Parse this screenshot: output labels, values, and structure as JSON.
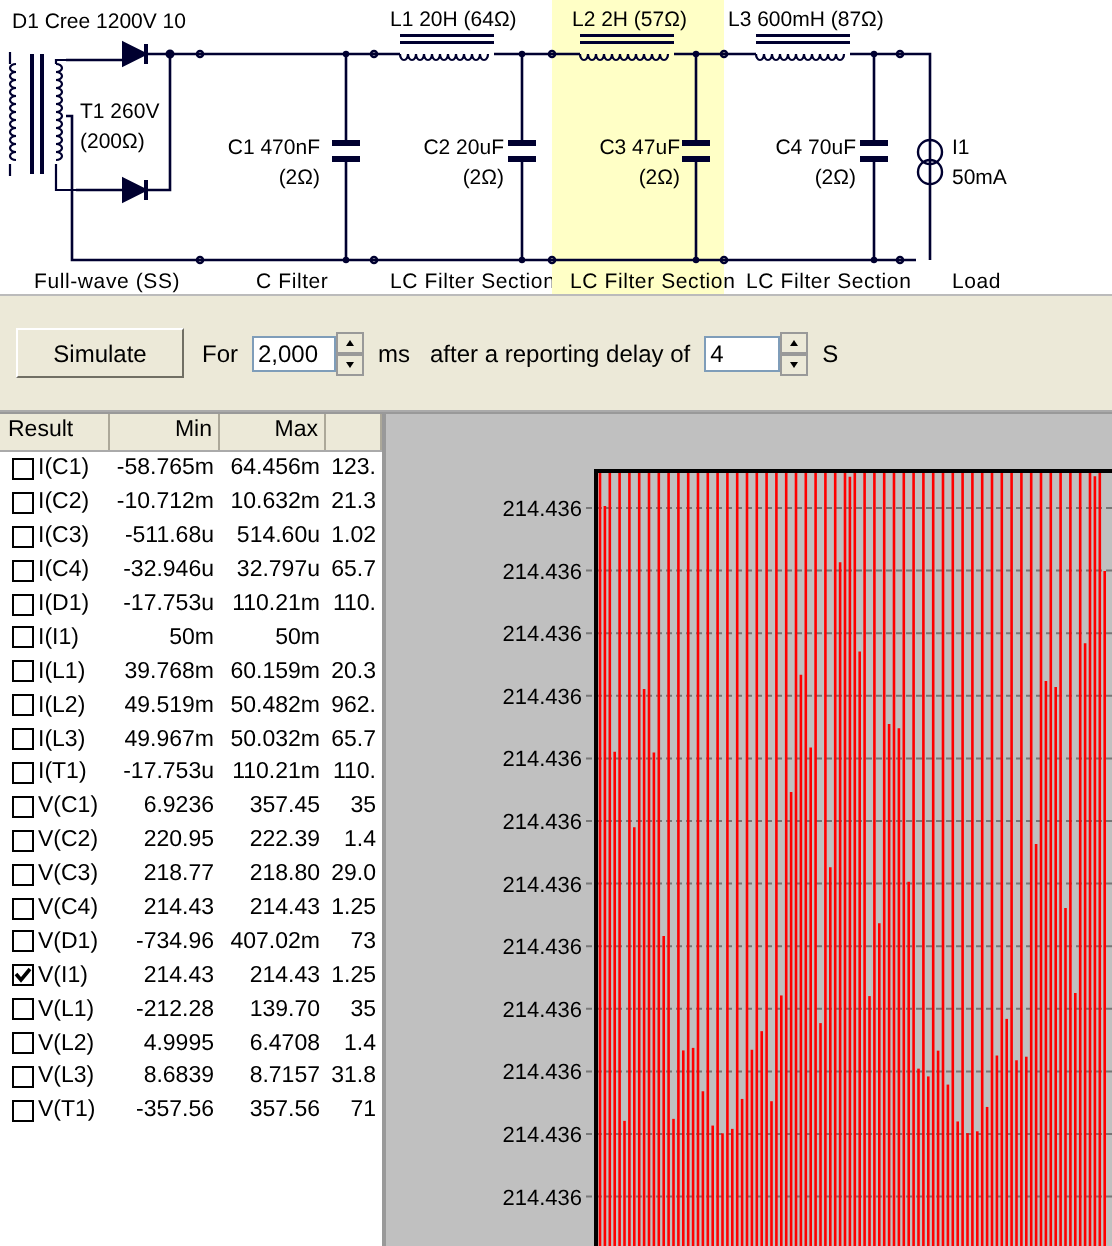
{
  "schematic": {
    "components": [
      {
        "kind": "diode",
        "name": "D1 Cree 1200V 10"
      },
      {
        "kind": "transformer",
        "name": "T1 260V",
        "detail": "(200Ω)"
      },
      {
        "kind": "capacitor",
        "name": "C1 470nF",
        "detail": "(2Ω)"
      },
      {
        "kind": "inductor",
        "name": "L1 20H (64Ω)"
      },
      {
        "kind": "capacitor",
        "name": "C2 20uF",
        "detail": "(2Ω)"
      },
      {
        "kind": "inductor",
        "name": "L2 2H (57Ω)"
      },
      {
        "kind": "capacitor",
        "name": "C3 47uF",
        "detail": "(2Ω)"
      },
      {
        "kind": "inductor",
        "name": "L3 600mH (87Ω)"
      },
      {
        "kind": "capacitor",
        "name": "C4 70uF",
        "detail": "(2Ω)"
      },
      {
        "kind": "current-source",
        "name": "I1",
        "detail": "50mA"
      }
    ],
    "sections": [
      {
        "label": "Full-wave (SS)",
        "selected": false
      },
      {
        "label": "C Filter",
        "selected": false
      },
      {
        "label": "LC Filter Section",
        "selected": false
      },
      {
        "label": "LC Filter Section",
        "selected": true
      },
      {
        "label": "LC Filter Section",
        "selected": false
      },
      {
        "label": "Load",
        "selected": false
      }
    ]
  },
  "toolbar": {
    "button": "Simulate",
    "for_label": "For",
    "duration": "2,000",
    "duration_unit": "ms",
    "delay_label": "after a reporting delay of",
    "delay": "4",
    "delay_unit": "S"
  },
  "results": {
    "columns": [
      "Result",
      "Min",
      "Max"
    ],
    "rows": [
      {
        "name": "I(C1)",
        "checked": false,
        "min": "-58.765m",
        "max": "64.456m",
        "column_4": "123."
      },
      {
        "name": "I(C2)",
        "checked": false,
        "min": "-10.712m",
        "max": "10.632m",
        "column_4": "21.3"
      },
      {
        "name": "I(C3)",
        "checked": false,
        "min": "-511.68u",
        "max": "514.60u",
        "column_4": "1.02"
      },
      {
        "name": "I(C4)",
        "checked": false,
        "min": "-32.946u",
        "max": "32.797u",
        "column_4": "65.7"
      },
      {
        "name": "I(D1)",
        "checked": false,
        "min": "-17.753u",
        "max": "110.21m",
        "column_4": "110."
      },
      {
        "name": "I(I1)",
        "checked": false,
        "min": "50m",
        "max": "50m"
      },
      {
        "name": "I(L1)",
        "checked": false,
        "min": "39.768m",
        "max": "60.159m",
        "column_4": "20.3"
      },
      {
        "name": "I(L2)",
        "checked": false,
        "min": "49.519m",
        "max": "50.482m",
        "column_4": "962."
      },
      {
        "name": "I(L3)",
        "checked": false,
        "min": "49.967m",
        "max": "50.032m",
        "column_4": "65.7"
      },
      {
        "name": "I(T1)",
        "checked": false,
        "min": "-17.753u",
        "max": "110.21m",
        "column_4": "110."
      },
      {
        "name": "V(C1)",
        "checked": false,
        "min": "6.9236",
        "max": "357.45",
        "column_4": "35"
      },
      {
        "name": "V(C2)",
        "checked": false,
        "min": "220.95",
        "max": "222.39",
        "column_4": "1.4"
      },
      {
        "name": "V(C3)",
        "checked": false,
        "min": "218.77",
        "max": "218.80",
        "column_4": "29.0"
      },
      {
        "name": "V(C4)",
        "checked": false,
        "min": "214.43",
        "max": "214.43",
        "column_4": "1.25"
      },
      {
        "name": "V(D1)",
        "checked": false,
        "min": "-734.96",
        "max": "407.02m",
        "column_4": "73"
      },
      {
        "name": "V(I1)",
        "checked": true,
        "min": "214.43",
        "max": "214.43",
        "column_4": "1.25"
      },
      {
        "name": "V(L1)",
        "checked": false,
        "min": "-212.28",
        "max": "139.70",
        "column_4": "35"
      },
      {
        "name": "V(L2)",
        "checked": false,
        "min": "4.9995",
        "max": "6.4708",
        "column_4": "1.4"
      },
      {
        "name": "V(L3)",
        "checked": false,
        "min": "8.6839",
        "max": "8.7157",
        "column_4": "31.8"
      },
      {
        "name": "V(T1)",
        "checked": false,
        "min": "-357.56",
        "max": "357.56",
        "column_4": "71"
      }
    ]
  },
  "plot": {
    "axis_labels": [
      "214.436",
      "214.436",
      "214.436",
      "214.436",
      "214.436",
      "214.436",
      "214.436",
      "214.436",
      "214.436",
      "214.436",
      "214.436",
      "214.436"
    ]
  }
}
